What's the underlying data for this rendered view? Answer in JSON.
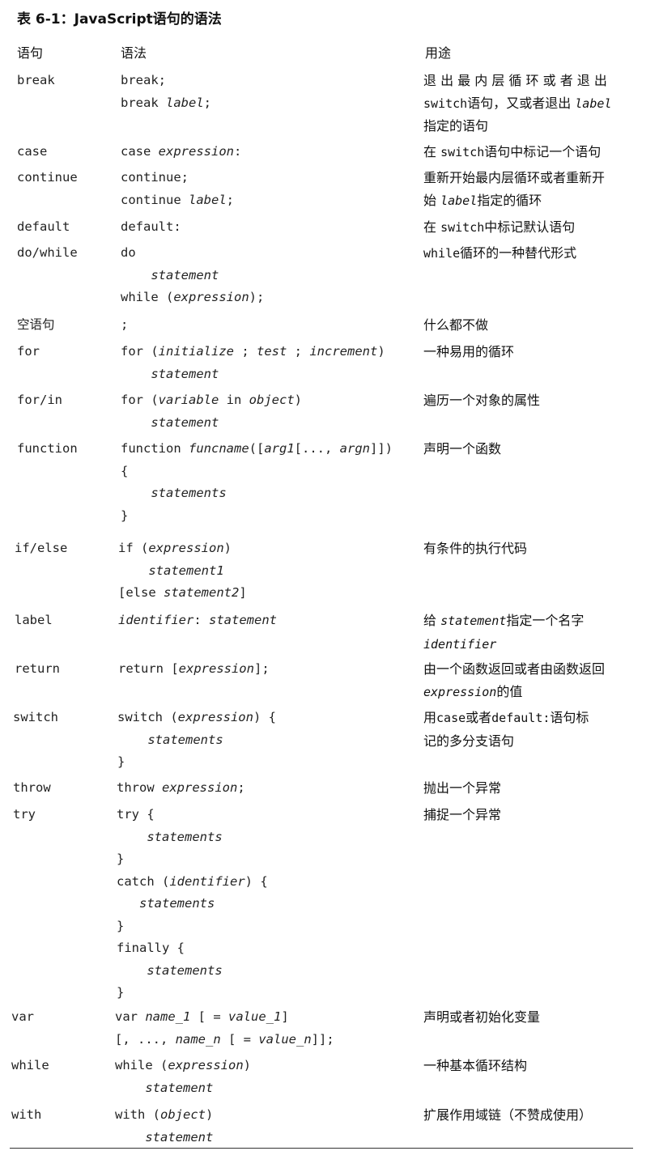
{
  "caption": "表 6-1：JavaScript语句的语法",
  "headers": {
    "statement": "语句",
    "syntax": "语法",
    "purpose": "用途"
  },
  "rows": [
    {
      "name": "break",
      "syntax": [
        [
          [
            "",
            "break;"
          ]
        ],
        [
          [
            "",
            "break "
          ],
          [
            "i",
            "label"
          ],
          [
            "",
            ";"
          ]
        ]
      ],
      "purpose": [
        [
          [
            "",
            "退 出 最 内 层 循 环 或 者 退 出"
          ]
        ],
        [
          [
            "m",
            "switch"
          ],
          [
            "",
            "语句，又或者退出 "
          ],
          [
            "mi",
            "label"
          ]
        ],
        [
          [
            "",
            "指定的语句"
          ]
        ]
      ]
    },
    {
      "name": "case",
      "syntax": [
        [
          [
            "",
            "case "
          ],
          [
            "i",
            "expression"
          ],
          [
            "",
            ":"
          ]
        ]
      ],
      "purpose": [
        [
          [
            "",
            "在 "
          ],
          [
            "m",
            "switch"
          ],
          [
            "",
            "语句中标记一个语句"
          ]
        ]
      ]
    },
    {
      "name": "continue",
      "syntax": [
        [
          [
            "",
            "continue;"
          ]
        ],
        [
          [
            "",
            "continue "
          ],
          [
            "i",
            "label"
          ],
          [
            "",
            ";"
          ]
        ]
      ],
      "purpose": [
        [
          [
            "",
            "重新开始最内层循环或者重新开"
          ]
        ],
        [
          [
            "",
            "始 "
          ],
          [
            "mi",
            "label"
          ],
          [
            "",
            "指定的循环"
          ]
        ]
      ]
    },
    {
      "name": "default",
      "syntax": [
        [
          [
            "",
            "default:"
          ]
        ]
      ],
      "purpose": [
        [
          [
            "",
            "在 "
          ],
          [
            "m",
            "switch"
          ],
          [
            "",
            "中标记默认语句"
          ]
        ]
      ]
    },
    {
      "name": "do/while",
      "syntax": [
        [
          [
            "",
            "do"
          ]
        ],
        [
          [
            "",
            "    "
          ],
          [
            "i",
            "statement"
          ]
        ],
        [
          [
            "",
            "while ("
          ],
          [
            "i",
            "expression"
          ],
          [
            "",
            ");"
          ]
        ]
      ],
      "purpose": [
        [
          [
            "m",
            "while"
          ],
          [
            "",
            "循环的一种替代形式"
          ]
        ]
      ]
    },
    {
      "name": "空语句",
      "syntax": [
        [
          [
            "",
            ";"
          ]
        ]
      ],
      "purpose": [
        [
          [
            "",
            "什么都不做"
          ]
        ]
      ]
    },
    {
      "name": "for",
      "syntax": [
        [
          [
            "",
            "for ("
          ],
          [
            "i",
            "initialize"
          ],
          [
            "",
            " ; "
          ],
          [
            "i",
            "test"
          ],
          [
            "",
            " ; "
          ],
          [
            "i",
            "increment"
          ],
          [
            "",
            ")"
          ]
        ],
        [
          [
            "",
            "    "
          ],
          [
            "i",
            "statement"
          ]
        ]
      ],
      "purpose": [
        [
          [
            "",
            "一种易用的循环"
          ]
        ]
      ]
    },
    {
      "name": "for/in",
      "syntax": [
        [
          [
            "",
            "for ("
          ],
          [
            "i",
            "variable"
          ],
          [
            "",
            " in "
          ],
          [
            "i",
            "object"
          ],
          [
            "",
            ")"
          ]
        ],
        [
          [
            "",
            "    "
          ],
          [
            "i",
            "statement"
          ]
        ]
      ],
      "purpose": [
        [
          [
            "",
            "遍历一个对象的属性"
          ]
        ]
      ]
    },
    {
      "name": "function",
      "syntax": [
        [
          [
            "",
            "function "
          ],
          [
            "i",
            "funcname"
          ],
          [
            "",
            "(["
          ],
          [
            "i",
            "arg1"
          ],
          [
            "",
            "[..., "
          ],
          [
            "i",
            "argn"
          ],
          [
            "",
            "]])"
          ]
        ],
        [
          [
            "",
            "{"
          ]
        ],
        [
          [
            "",
            "    "
          ],
          [
            "i",
            "statements"
          ]
        ],
        [
          [
            "",
            "}"
          ]
        ]
      ],
      "purpose": [
        [
          [
            "",
            "声明一个函数"
          ]
        ]
      ]
    },
    {
      "name": "if/else",
      "syntax": [
        [
          [
            "",
            "if ("
          ],
          [
            "i",
            "expression"
          ],
          [
            "",
            ")"
          ]
        ],
        [
          [
            "",
            "    "
          ],
          [
            "i",
            "statement1"
          ]
        ],
        [
          [
            "",
            "[else "
          ],
          [
            "i",
            "statement2"
          ],
          [
            "",
            "]"
          ]
        ]
      ],
      "purpose": [
        [
          [
            "",
            "有条件的执行代码"
          ]
        ]
      ]
    },
    {
      "name": "label",
      "syntax": [
        [
          [
            "i",
            "identifier"
          ],
          [
            "",
            ": "
          ],
          [
            "i",
            "statement"
          ]
        ]
      ],
      "purpose": [
        [
          [
            "",
            "给 "
          ],
          [
            "mi",
            "statement"
          ],
          [
            "",
            "指定一个名字"
          ]
        ],
        [
          [
            "mi",
            "identifier"
          ]
        ]
      ]
    },
    {
      "name": "return",
      "syntax": [
        [
          [
            "",
            "return ["
          ],
          [
            "i",
            "expression"
          ],
          [
            "",
            "];"
          ]
        ]
      ],
      "purpose": [
        [
          [
            "",
            "由一个函数返回或者由函数返回"
          ]
        ],
        [
          [
            "mi",
            "expression"
          ],
          [
            "",
            "的值"
          ]
        ]
      ]
    },
    {
      "name": "switch",
      "syntax": [
        [
          [
            "",
            "switch ("
          ],
          [
            "i",
            "expression"
          ],
          [
            "",
            ") {"
          ]
        ],
        [
          [
            "",
            "    "
          ],
          [
            "i",
            "statements"
          ]
        ],
        [
          [
            "",
            "}"
          ]
        ]
      ],
      "purpose": [
        [
          [
            "",
            "用"
          ],
          [
            "m",
            "case"
          ],
          [
            "",
            "或者"
          ],
          [
            "m",
            "default:"
          ],
          [
            "",
            "语句标"
          ]
        ],
        [
          [
            "",
            "记的多分支语句"
          ]
        ]
      ]
    },
    {
      "name": "throw",
      "syntax": [
        [
          [
            "",
            "throw "
          ],
          [
            "i",
            "expression"
          ],
          [
            "",
            ";"
          ]
        ]
      ],
      "purpose": [
        [
          [
            "",
            "抛出一个异常"
          ]
        ]
      ]
    },
    {
      "name": "try",
      "syntax": [
        [
          [
            "",
            "try {"
          ]
        ],
        [
          [
            "",
            "    "
          ],
          [
            "i",
            "statements"
          ]
        ],
        [
          [
            "",
            "}"
          ]
        ],
        [
          [
            "",
            "catch ("
          ],
          [
            "i",
            "identifier"
          ],
          [
            "",
            ") {"
          ]
        ],
        [
          [
            "",
            "   "
          ],
          [
            "i",
            "statements"
          ]
        ],
        [
          [
            "",
            "}"
          ]
        ],
        [
          [
            "",
            "finally {"
          ]
        ],
        [
          [
            "",
            "    "
          ],
          [
            "i",
            "statements"
          ]
        ],
        [
          [
            "",
            "}"
          ]
        ]
      ],
      "purpose": [
        [
          [
            "",
            "捕捉一个异常"
          ]
        ]
      ]
    },
    {
      "name": "var",
      "syntax": [
        [
          [
            "",
            "var "
          ],
          [
            "i",
            "name_1"
          ],
          [
            "",
            " [ = "
          ],
          [
            "i",
            "value_1"
          ],
          [
            "",
            "]"
          ]
        ],
        [
          [
            "",
            "[, ..., "
          ],
          [
            "i",
            "name_n"
          ],
          [
            "",
            " [ = "
          ],
          [
            "i",
            "value_n"
          ],
          [
            "",
            "]];"
          ]
        ]
      ],
      "purpose": [
        [
          [
            "",
            "声明或者初始化变量"
          ]
        ]
      ]
    },
    {
      "name": "while",
      "syntax": [
        [
          [
            "",
            "while ("
          ],
          [
            "i",
            "expression"
          ],
          [
            "",
            ")"
          ]
        ],
        [
          [
            "",
            "    "
          ],
          [
            "i",
            "statement"
          ]
        ]
      ],
      "purpose": [
        [
          [
            "",
            "一种基本循环结构"
          ]
        ]
      ]
    },
    {
      "name": "with",
      "syntax": [
        [
          [
            "",
            "with ("
          ],
          [
            "i",
            "object"
          ],
          [
            "",
            ")"
          ]
        ],
        [
          [
            "",
            "    "
          ],
          [
            "i",
            "statement"
          ]
        ]
      ],
      "purpose": [
        [
          [
            "",
            "扩展作用域链（不赞成使用）"
          ]
        ]
      ]
    }
  ]
}
